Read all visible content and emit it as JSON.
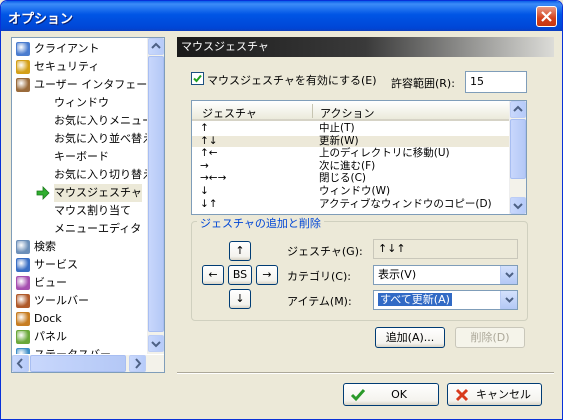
{
  "window": {
    "title": "オプション"
  },
  "tree": {
    "items": [
      {
        "label": "クライアント",
        "icon": "client-icon",
        "color": "#4a7ccf"
      },
      {
        "label": "セキュリティ",
        "icon": "shield-icon",
        "color": "#d4a018"
      },
      {
        "label": "ユーザー インタフェース",
        "icon": "users-icon",
        "color": "#9a6b3b"
      },
      {
        "label": "ウィンドウ"
      },
      {
        "label": "お気に入りメニュー"
      },
      {
        "label": "お気に入り並べ替え"
      },
      {
        "label": "キーボード"
      },
      {
        "label": "お気に入り切り替え"
      },
      {
        "label": "マウスジェスチャ",
        "icon": "green-arrow-icon",
        "selected": true
      },
      {
        "label": "マウス割り当て"
      },
      {
        "label": "メニューエディタ"
      },
      {
        "label": "検索",
        "icon": "magnifier-icon",
        "color": "#6c8fb8"
      },
      {
        "label": "サービス",
        "icon": "globe-icon",
        "color": "#3a6fc4"
      },
      {
        "label": "ビュー",
        "icon": "cube-icon",
        "color": "#a64fb0"
      },
      {
        "label": "ツールバー",
        "icon": "cube-icon",
        "color": "#b05a2a"
      },
      {
        "label": "Dock",
        "icon": "cube-icon",
        "color": "#c77d22"
      },
      {
        "label": "パネル",
        "icon": "cube-icon",
        "color": "#6aa83a"
      },
      {
        "label": "ステータスバー",
        "icon": "cube-icon",
        "color": "#3f8fc7"
      }
    ]
  },
  "panel": {
    "header": "マウスジェスチャ",
    "enable_label": "マウスジェスチャを有効にする(E)",
    "enable_checked": true,
    "tolerance_label": "許容範囲(R):",
    "tolerance_value": "15",
    "list": {
      "columns": [
        "ジェスチャ",
        "アクション"
      ],
      "rows": [
        {
          "gesture": "↑",
          "action": "中止(T)"
        },
        {
          "gesture": "↑↓",
          "action": "更新(W)",
          "highlight": true
        },
        {
          "gesture": "↑←",
          "action": "上のディレクトリに移動(U)"
        },
        {
          "gesture": "→",
          "action": "次に進む(F)"
        },
        {
          "gesture": "→←→",
          "action": "閉じる(C)"
        },
        {
          "gesture": "↓",
          "action": "ウィンドウ(W)"
        },
        {
          "gesture": "↓↑",
          "action": "アクティブなウィンドウのコピー(D)"
        }
      ]
    },
    "group": {
      "title": "ジェスチャの追加と削除",
      "up": "↑",
      "left": "←",
      "bs": "BS",
      "right": "→",
      "down": "↓",
      "gesture_label": "ジェスチャ(G):",
      "gesture_value": "↑↓↑",
      "category_label": "カテゴリ(C):",
      "category_value": "表示(V)",
      "item_label": "アイテム(M):",
      "item_value": "すべて更新(A)"
    },
    "add_button": "追加(A)...",
    "delete_button": "削除(D)"
  },
  "footer": {
    "ok": "OK",
    "cancel": "キャンセル"
  }
}
